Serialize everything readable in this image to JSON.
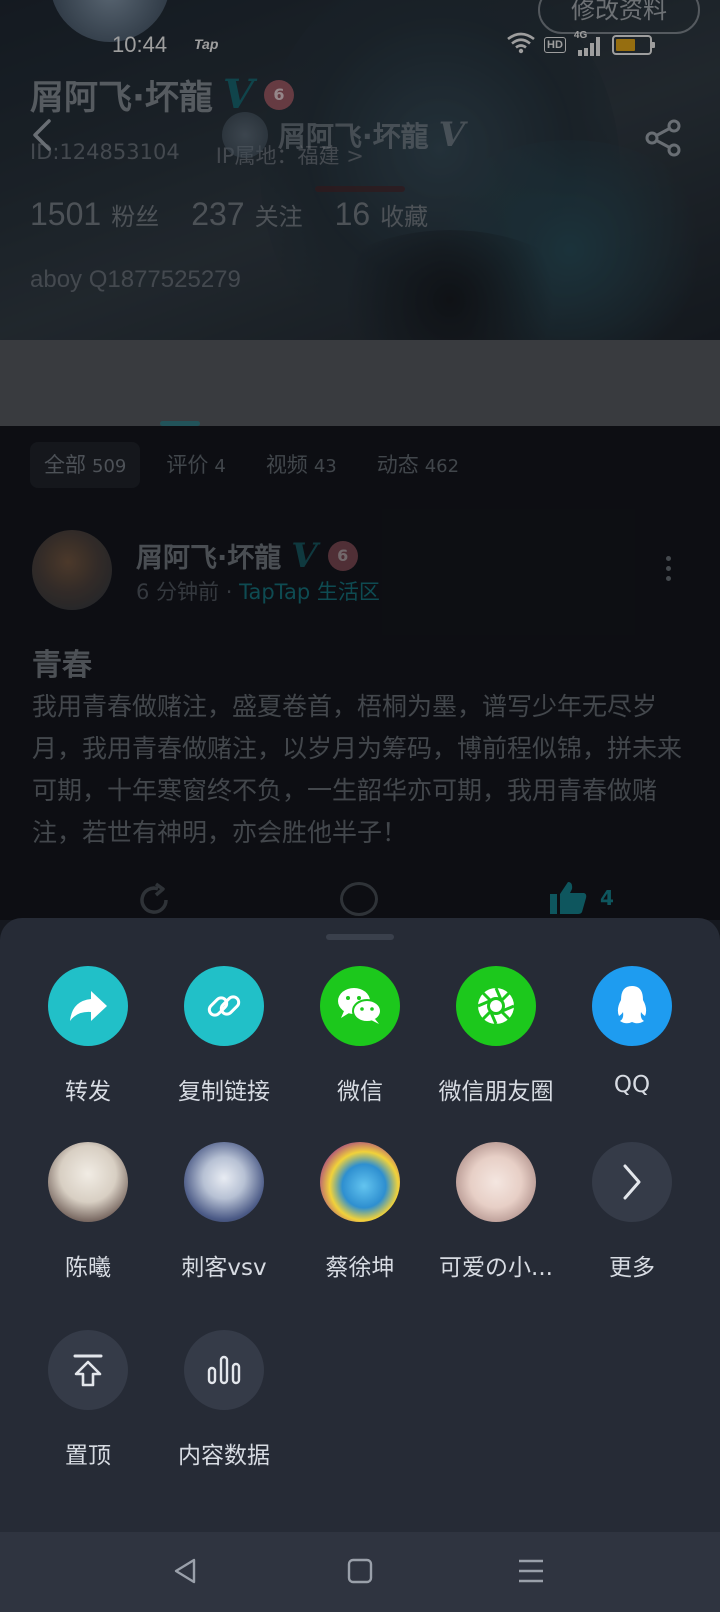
{
  "status_bar": {
    "time": "10:44",
    "app_tag": "Tap",
    "network": "4G",
    "hd": "HD",
    "battery_level": 0.6,
    "battery_color": "#f2b21b"
  },
  "header": {
    "title": "屑阿飞·坏龍",
    "edit_profile": "修改资料",
    "back_icon": "chevron-left-icon",
    "share_icon": "share-icon"
  },
  "profile": {
    "name": "屑阿飞·坏龍",
    "verified": "V",
    "level": "6",
    "id_text": "ID:124853104",
    "ip_text": "IP属地：福建 >",
    "stats": [
      {
        "num": "1501",
        "label": "粉丝"
      },
      {
        "num": "237",
        "label": "关注"
      },
      {
        "num": "16",
        "label": "收藏"
      }
    ],
    "bio": "aboy Q1877525279"
  },
  "filters": [
    {
      "label": "全部",
      "count": "509"
    },
    {
      "label": "评价",
      "count": "4"
    },
    {
      "label": "视频",
      "count": "43"
    },
    {
      "label": "动态",
      "count": "462"
    }
  ],
  "post": {
    "author": "屑阿飞·坏龍",
    "verified": "V",
    "level": "6",
    "time": "6 分钟前",
    "separator": "·",
    "zone": "TapTap 生活区",
    "title": "青春",
    "body": "我用青春做赌注，盛夏卷首，梧桐为墨，谱写少年无尽岁月，我用青春做赌注，以岁月为筹码，博前程似锦，拼未来可期，十年寒窗终不负，一生韶华亦可期，我用青春做赌注，若世有神明，亦会胜他半子！",
    "likes": "4"
  },
  "share_sheet": {
    "row1": [
      {
        "label": "转发",
        "icon": "forward-icon"
      },
      {
        "label": "复制链接",
        "icon": "link-icon"
      },
      {
        "label": "微信",
        "icon": "wechat-icon"
      },
      {
        "label": "微信朋友圈",
        "icon": "moments-icon"
      },
      {
        "label": "QQ",
        "icon": "qq-icon"
      }
    ],
    "row2": [
      {
        "label": "陈曦"
      },
      {
        "label": "刺客vsv"
      },
      {
        "label": "蔡徐坤"
      },
      {
        "label": "可爱の小..."
      },
      {
        "label": "更多",
        "icon": "chevron-right-icon"
      }
    ],
    "row3": [
      {
        "label": "置顶",
        "icon": "pin-top-icon"
      },
      {
        "label": "内容数据",
        "icon": "bar-chart-icon"
      }
    ],
    "colors": {
      "teal": "#21c0c8",
      "wechat_green": "#1cc81c",
      "qq_blue": "#1e9cf0"
    }
  },
  "system_nav": {
    "back": "triangle-back-icon",
    "home": "square-home-icon",
    "menu": "menu-icon"
  }
}
